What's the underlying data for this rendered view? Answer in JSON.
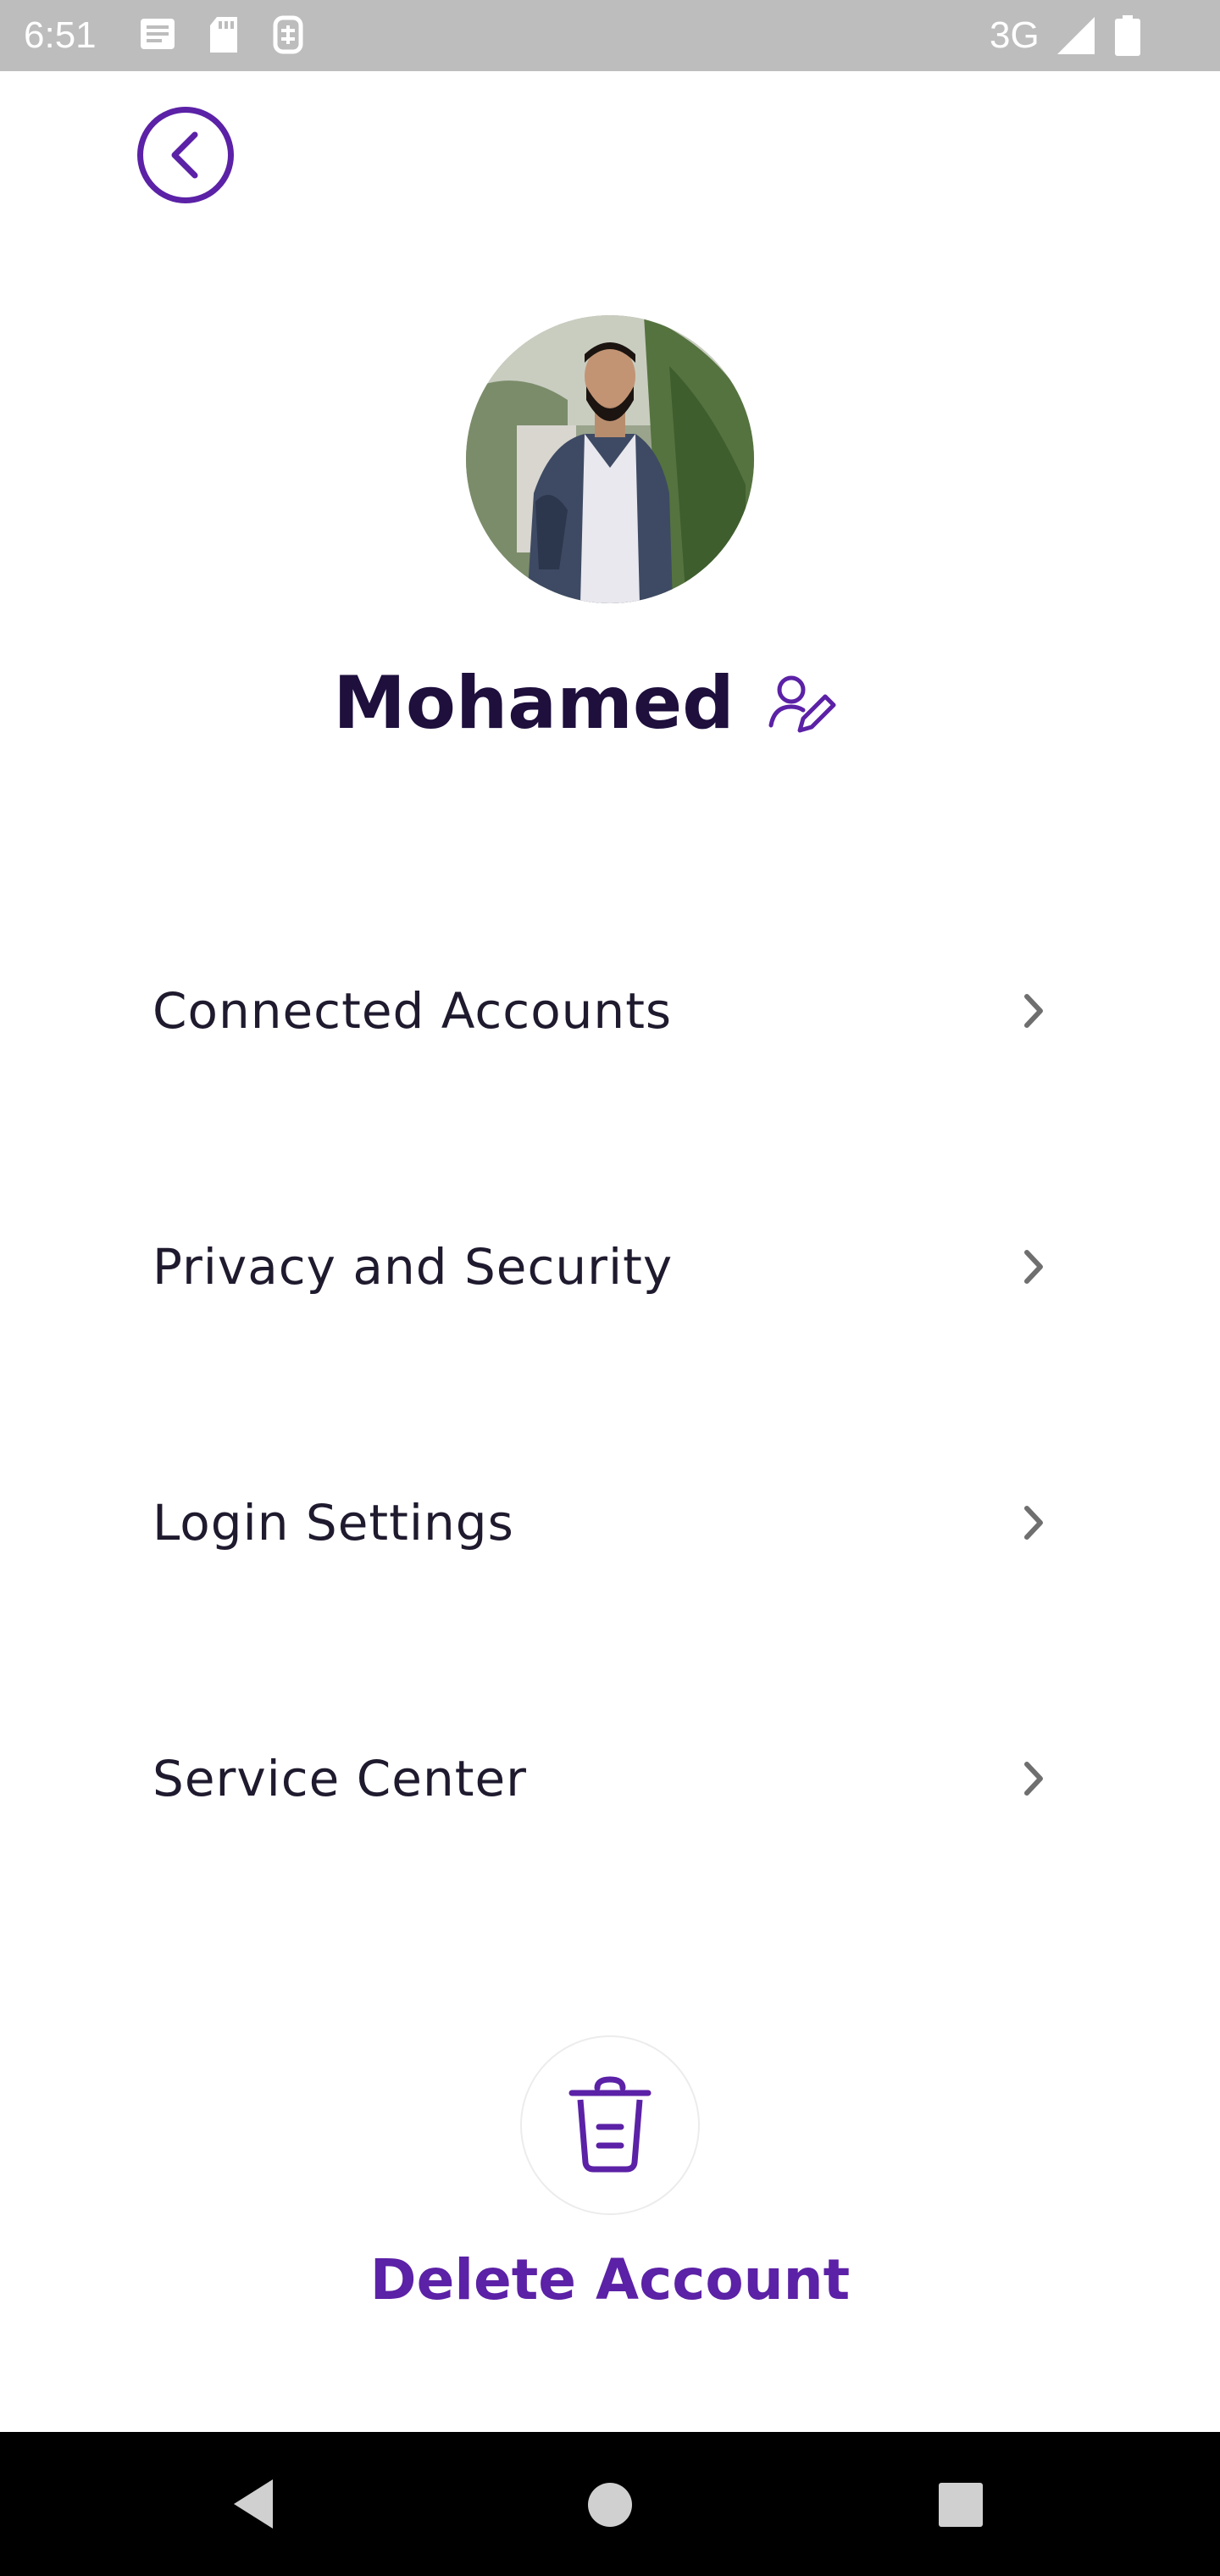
{
  "status_bar": {
    "time": "6:51",
    "network": "3G",
    "icons": [
      "notification-icon",
      "sd-card-icon",
      "sim-icon",
      "signal-icon",
      "battery-icon"
    ]
  },
  "header": {
    "back_icon": "chevron-left-circle-icon"
  },
  "profile": {
    "avatar": "profile-photo",
    "name": "Mohamed",
    "edit_icon": "user-edit-icon"
  },
  "menu": {
    "items": [
      {
        "label": "Connected Accounts",
        "icon": "chevron-right-icon"
      },
      {
        "label": "Privacy and Security",
        "icon": "chevron-right-icon"
      },
      {
        "label": "Login Settings",
        "icon": "chevron-right-icon"
      },
      {
        "label": "Service Center",
        "icon": "chevron-right-icon"
      }
    ]
  },
  "delete": {
    "icon": "trash-icon",
    "label": "Delete Account"
  },
  "nav_bar": {
    "icons": [
      "nav-back-icon",
      "nav-home-icon",
      "nav-recents-icon"
    ]
  },
  "colors": {
    "accent": "#5b21a6",
    "name_text": "#1e0f3d",
    "menu_text": "#1f1a2e",
    "status_bar": "#bdbdbd",
    "nav_bar": "#000000"
  }
}
